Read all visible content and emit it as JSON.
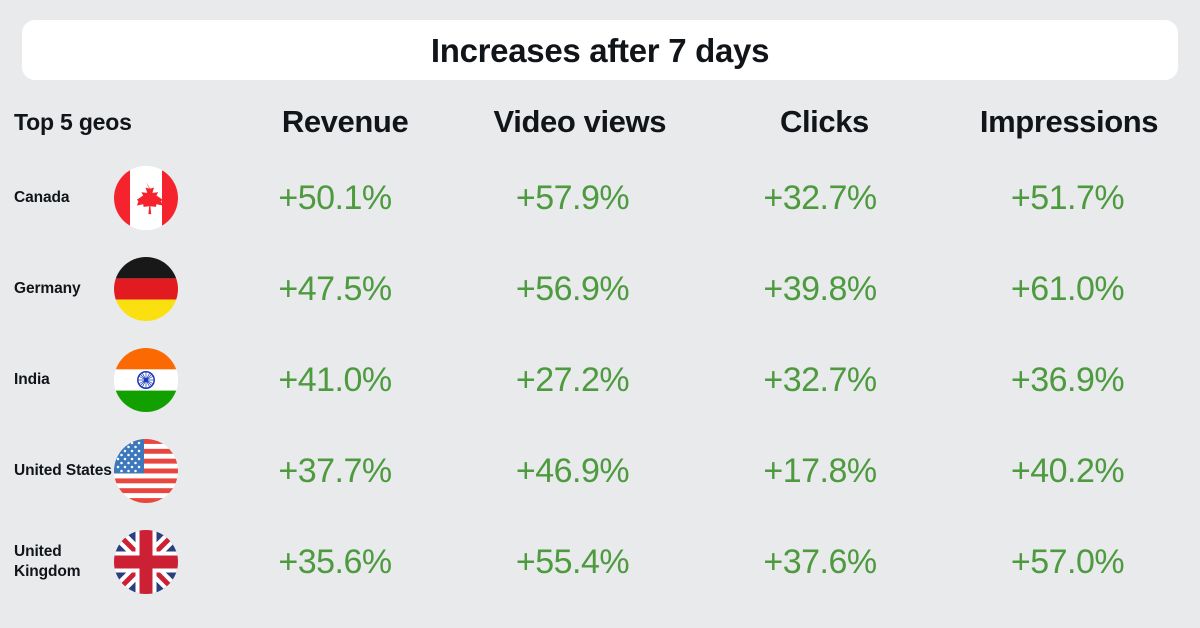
{
  "banner": {
    "title": "Increases after 7 days"
  },
  "table": {
    "headers": {
      "geo": "Top 5 geos",
      "metrics": [
        "Revenue",
        "Video views",
        "Clicks",
        "Impressions"
      ]
    },
    "rows": [
      {
        "geo": "Canada",
        "flag": "flag-canada-icon",
        "revenue": "+50.1%",
        "video_views": "+57.9%",
        "clicks": "+32.7%",
        "impressions": "+51.7%"
      },
      {
        "geo": "Germany",
        "flag": "flag-germany-icon",
        "revenue": "+47.5%",
        "video_views": "+56.9%",
        "clicks": "+39.8%",
        "impressions": "+61.0%"
      },
      {
        "geo": "India",
        "flag": "flag-india-icon",
        "revenue": "+41.0%",
        "video_views": "+27.2%",
        "clicks": "+32.7%",
        "impressions": "+36.9%"
      },
      {
        "geo": "United States",
        "flag": "flag-united-states-icon",
        "revenue": "+37.7%",
        "video_views": "+46.9%",
        "clicks": "+17.8%",
        "impressions": "+40.2%"
      },
      {
        "geo": "United Kingdom",
        "flag": "flag-united-kingdom-icon",
        "revenue": "+35.6%",
        "video_views": "+55.4%",
        "clicks": "+37.6%",
        "impressions": "+57.0%"
      }
    ]
  },
  "colors": {
    "background": "#e8eaec",
    "banner": "#ffffff",
    "text": "#111418",
    "positive": "#4e9a3f"
  },
  "chart_data": {
    "type": "table",
    "title": "Increases after 7 days",
    "row_header": "Top 5 geos",
    "columns": [
      "Revenue",
      "Video views",
      "Clicks",
      "Impressions"
    ],
    "categories": [
      "Canada",
      "Germany",
      "India",
      "United States",
      "United Kingdom"
    ],
    "series": [
      {
        "name": "Revenue",
        "values": [
          50.1,
          47.5,
          41.0,
          37.7,
          35.6
        ]
      },
      {
        "name": "Video views",
        "values": [
          57.9,
          56.9,
          27.2,
          46.9,
          55.4
        ]
      },
      {
        "name": "Clicks",
        "values": [
          32.7,
          39.8,
          32.7,
          17.8,
          37.6
        ]
      },
      {
        "name": "Impressions",
        "values": [
          51.7,
          61.0,
          36.9,
          40.2,
          57.0
        ]
      }
    ],
    "unit": "percent",
    "value_prefix": "+"
  }
}
